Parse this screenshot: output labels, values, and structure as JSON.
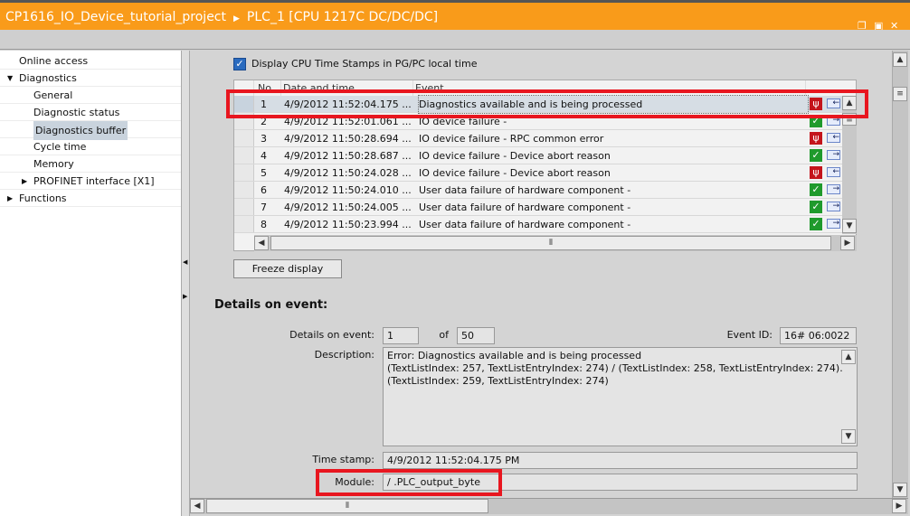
{
  "title": {
    "project": "CP1616_IO_Device_tutorial_project",
    "device": "PLC_1 [CPU 1217C DC/DC/DC]"
  },
  "nav": [
    {
      "label": "Online access",
      "level": 0,
      "expander": ""
    },
    {
      "label": "Diagnostics",
      "level": 0,
      "expander": "expanded"
    },
    {
      "label": "General",
      "level": 1,
      "expander": ""
    },
    {
      "label": "Diagnostic status",
      "level": 1,
      "expander": ""
    },
    {
      "label": "Diagnostics buffer",
      "level": 1,
      "expander": "",
      "selected": true
    },
    {
      "label": "Cycle time",
      "level": 1,
      "expander": ""
    },
    {
      "label": "Memory",
      "level": 1,
      "expander": ""
    },
    {
      "label": "PROFINET interface [X1]",
      "level": 1,
      "expander": "collapsed"
    },
    {
      "label": "Functions",
      "level": 0,
      "expander": "collapsed"
    }
  ],
  "timestamps_checkbox": {
    "label": "Display CPU Time Stamps in PG/PC local time",
    "checked": true
  },
  "table": {
    "headers": {
      "no": "No.",
      "date": "Date and time",
      "event": "Event"
    },
    "rows": [
      {
        "no": "1",
        "date": "4/9/2012 11:52:04.175 ...",
        "event": "Diagnostics available and is being processed",
        "status": "error",
        "direction": "incoming"
      },
      {
        "no": "2",
        "date": "4/9/2012 11:52:01.061 ...",
        "event": "IO device failure -",
        "status": "ok",
        "direction": "outgoing"
      },
      {
        "no": "3",
        "date": "4/9/2012 11:50:28.694 ...",
        "event": "IO device failure - RPC common error",
        "status": "error",
        "direction": "incoming"
      },
      {
        "no": "4",
        "date": "4/9/2012 11:50:28.687 ...",
        "event": "IO device failure - Device abort reason",
        "status": "ok",
        "direction": "outgoing"
      },
      {
        "no": "5",
        "date": "4/9/2012 11:50:24.028 ...",
        "event": "IO device failure - Device abort reason",
        "status": "error",
        "direction": "incoming"
      },
      {
        "no": "6",
        "date": "4/9/2012 11:50:24.010 ...",
        "event": "User data failure of hardware component -",
        "status": "ok",
        "direction": "outgoing"
      },
      {
        "no": "7",
        "date": "4/9/2012 11:50:24.005 ...",
        "event": "User data failure of hardware component -",
        "status": "ok",
        "direction": "outgoing"
      },
      {
        "no": "8",
        "date": "4/9/2012 11:50:23.994 ...",
        "event": "User data failure of hardware component -",
        "status": "ok",
        "direction": "outgoing"
      }
    ]
  },
  "freeze_button": "Freeze display",
  "details": {
    "heading": "Details on event:",
    "event_label": "Details on event:",
    "event_value": "1",
    "of_label": "of",
    "of_value": "50",
    "event_id_label": "Event ID:",
    "event_id_value": "16# 06:0022",
    "description_label": "Description:",
    "description_lines": [
      "Error: Diagnostics available and is being processed",
      " (TextListIndex: 257, TextListEntryIndex: 274) / (TextListIndex: 258, TextListEntryIndex: 274).",
      "(TextListIndex: 259, TextListEntryIndex: 274)"
    ],
    "timestamp_label": "Time stamp:",
    "timestamp_value": "4/9/2012 11:52:04.175 PM",
    "module_label": "Module:",
    "module_value": "/ .PLC_output_byte"
  },
  "colors": {
    "titlebar": "#f99b1a",
    "highlight": "#e8161f"
  }
}
